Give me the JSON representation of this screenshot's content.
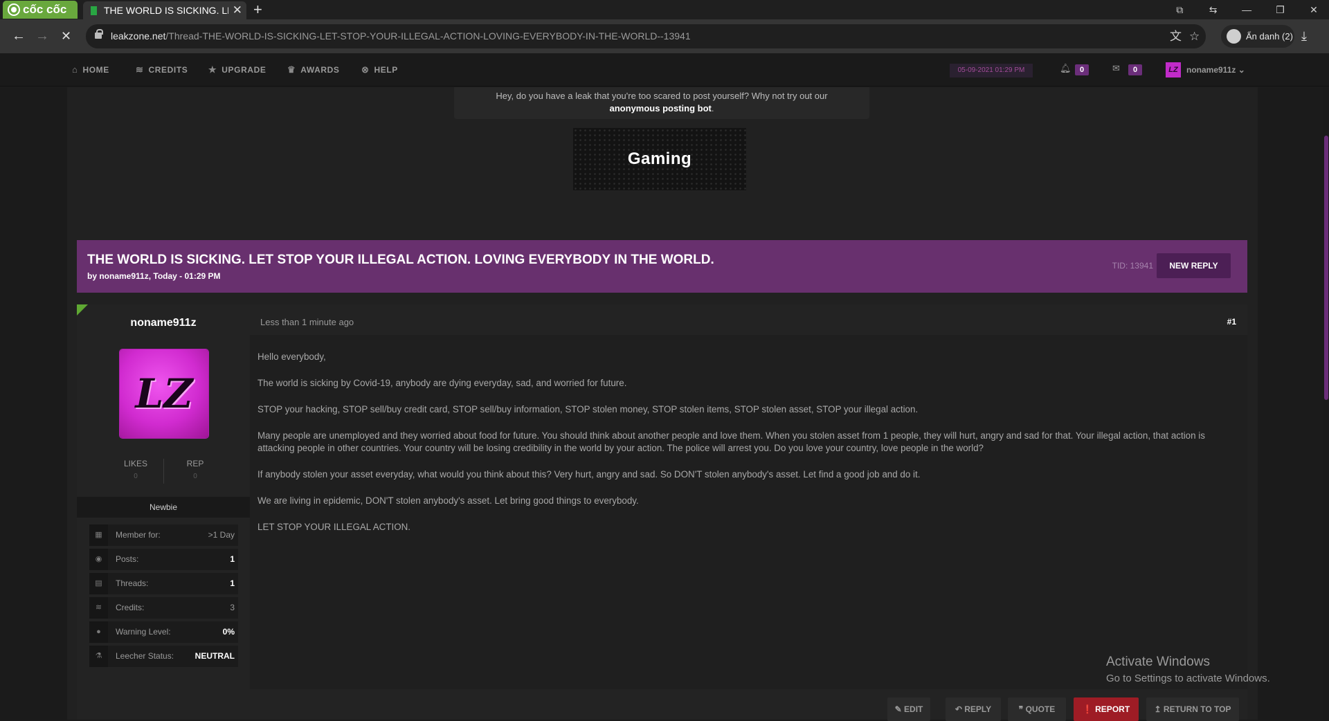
{
  "browser": {
    "brand": "cốc cốc",
    "tab_title": "THE WORLD IS SICKING. LET",
    "tab_close": "✕",
    "new_tab": "+",
    "url_host": "leakzone.net",
    "url_path": "/Thread-THE-WORLD-IS-SICKING-LET-STOP-YOUR-ILLEGAL-ACTION-LOVING-EVERYBODY-IN-THE-WORLD--13941",
    "incognito_label": "Ẩn danh (2)"
  },
  "nav": {
    "home": "HOME",
    "credits": "CREDITS",
    "upgrade": "UPGRADE",
    "awards": "AWARDS",
    "help": "HELP",
    "datetime": "05-09-2021 01:29 PM",
    "notif_count": "0",
    "msg_count": "0",
    "avatar_text": "LZ",
    "username": "noname911z"
  },
  "notice": {
    "line1": "Hey, do you have a leak that you're too scared to post yourself? Why not try out our",
    "link": "anonymous posting bot",
    "end": "."
  },
  "banner": {
    "text": "Gaming"
  },
  "thread": {
    "title": "THE WORLD IS SICKING. LET STOP YOUR ILLEGAL ACTION. LOVING EVERYBODY IN THE WORLD.",
    "byline": "by noname911z, Today - 01:29 PM",
    "tid": "TID: 13941",
    "new_reply": "NEW REPLY"
  },
  "post": {
    "author": "noname911z",
    "avatar_text": "LZ",
    "likes_label": "LIKES",
    "likes_value": "0",
    "rep_label": "REP",
    "rep_value": "0",
    "rank": "Newbie",
    "stats": [
      {
        "label": "Member for:",
        "value": ">1 Day"
      },
      {
        "label": "Posts:",
        "value": "1"
      },
      {
        "label": "Threads:",
        "value": "1"
      },
      {
        "label": "Credits:",
        "value": "3"
      },
      {
        "label": "Warning Level:",
        "value": "0%"
      },
      {
        "label": "Leecher Status:",
        "value": "NEUTRAL"
      }
    ],
    "time": "Less than 1 minute ago",
    "number": "#1",
    "paragraphs": [
      "Hello everybody,",
      "The world is sicking by Covid-19, anybody are dying everyday, sad, and worried for future.",
      "STOP your hacking, STOP sell/buy credit card, STOP sell/buy information, STOP stolen money, STOP stolen items, STOP stolen asset, STOP your illegal action.",
      "Many people are unemployed and they worried about food for future. You should think about another people and love them. When you stolen asset from 1 people, they will hurt, angry and sad for that. Your illegal action, that action is attacking people in other countries. Your country will be losing credibility in the world by your action. The police will arrest you. Do you love your country, love people in the world?",
      "If anybody stolen your asset everyday, what would you think about this? Very hurt, angry and sad. So DON'T stolen anybody's asset. Let find a good job and do it.",
      "We are living in epidemic, DON'T stolen anybody's asset. Let bring good things to everybody.",
      "LET STOP YOUR ILLEGAL ACTION."
    ],
    "actions": {
      "edit": "EDIT",
      "reply": "REPLY",
      "quote": "QUOTE",
      "report": "REPORT",
      "top": "RETURN TO TOP"
    }
  },
  "watermark": {
    "line1": "Activate Windows",
    "line2": "Go to Settings to activate Windows."
  },
  "colors": {
    "accent_purple": "#68306e",
    "brand_green": "#69a83d",
    "report_red": "#9e1c25",
    "avatar_magenta": "#d12bd0"
  }
}
